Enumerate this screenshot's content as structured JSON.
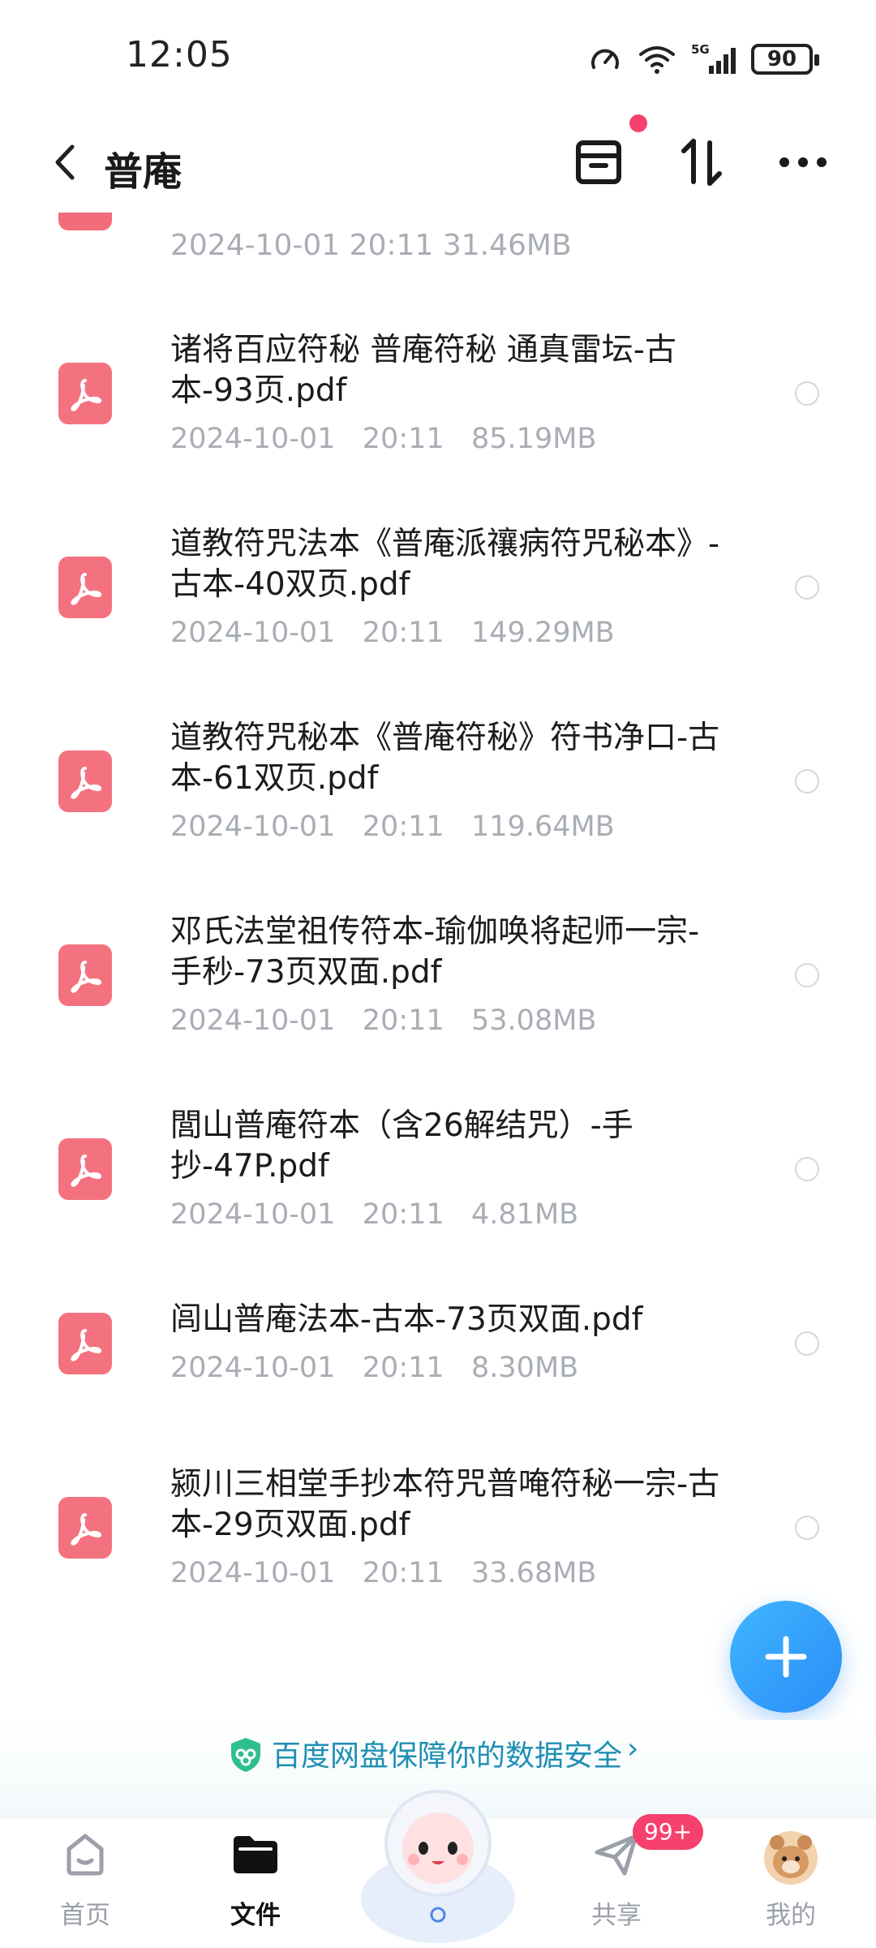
{
  "status_bar": {
    "time": "12:05",
    "battery": "90"
  },
  "header": {
    "title": "普庵"
  },
  "partial_row": {
    "meta": "2024-10-01   20:11   31.46MB"
  },
  "files": [
    {
      "name": "诸将百应符秘 普庵符秘 通真雷坛-古本-93页.pdf",
      "meta": "2024-10-01   20:11   85.19MB"
    },
    {
      "name": "道教符咒法本《普庵派禳病符咒秘本》-古本-40双页.pdf",
      "meta": "2024-10-01   20:11   149.29MB"
    },
    {
      "name": "道教符咒秘本《普庵符秘》符书净口-古本-61双页.pdf",
      "meta": "2024-10-01   20:11   119.64MB"
    },
    {
      "name": "邓氏法堂祖传符本-瑜伽唤将起师一宗-手秒-73页双面.pdf",
      "meta": "2024-10-01   20:11   53.08MB"
    },
    {
      "name": "閭山普庵符本（含26解结咒）-手抄-47P.pdf",
      "meta": "2024-10-01   20:11   4.81MB"
    },
    {
      "name": "闾山普庵法本-古本-73页双面.pdf",
      "meta": "2024-10-01   20:11   8.30MB"
    },
    {
      "name": "颍川三相堂手抄本符咒普唵符秘一宗-古本-29页双面.pdf",
      "meta": "2024-10-01   20:11   33.68MB"
    }
  ],
  "banner": {
    "text": "百度网盘保障你的数据安全",
    "arrow": "›"
  },
  "nav": {
    "home": "首页",
    "files": "文件",
    "share": "共享",
    "share_badge": "99+",
    "mine": "我的"
  },
  "colors": {
    "accent": "#2a8df7",
    "pdf": "#f4727f",
    "badge": "#f5416c",
    "banner_text": "#1f8fb3"
  }
}
